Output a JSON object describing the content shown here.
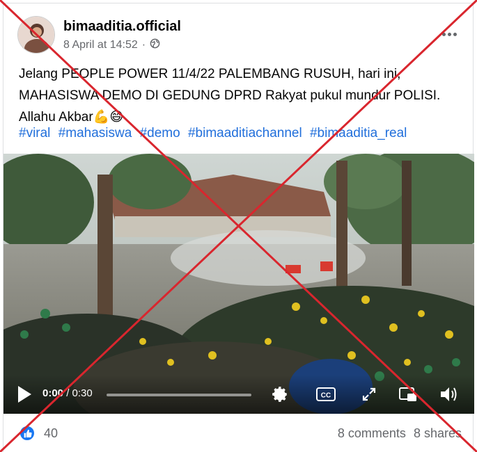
{
  "post": {
    "author": "bimaaditia.official",
    "timestamp": "8 April at 14:52",
    "separator": "·",
    "privacy_icon": "globe-icon",
    "text_lines": [
      "Jelang PEOPLE POWER 11/4/22 PALEMBANG RUSUH, hari ini,",
      "MAHASISWA DEMO DI GEDUNG DPRD Rakyat  pukul  mundur POLISI.",
      "Allahu Akbar💪😄"
    ],
    "hashtags": [
      "#viral",
      "#mahasiswa",
      "#demo",
      " #bimaaditiachannel",
      "#bimaaditia_real"
    ]
  },
  "video": {
    "current_time": "0:00",
    "time_separator": "/",
    "duration": "0:30",
    "progress": 0.0,
    "icons": [
      "play-icon",
      "gear-icon",
      "closed-captions-icon",
      "fullscreen-icon",
      "picture-in-picture-icon",
      "volume-icon"
    ]
  },
  "footer": {
    "reaction_icon": "like-icon",
    "reaction_count": "40",
    "comments": "8 comments",
    "shares": "8 shares"
  },
  "colors": {
    "link": "#216fdb",
    "secondary_text": "#65676b",
    "like_blue": "#1877f2",
    "overlay_x": "#d9262e"
  }
}
